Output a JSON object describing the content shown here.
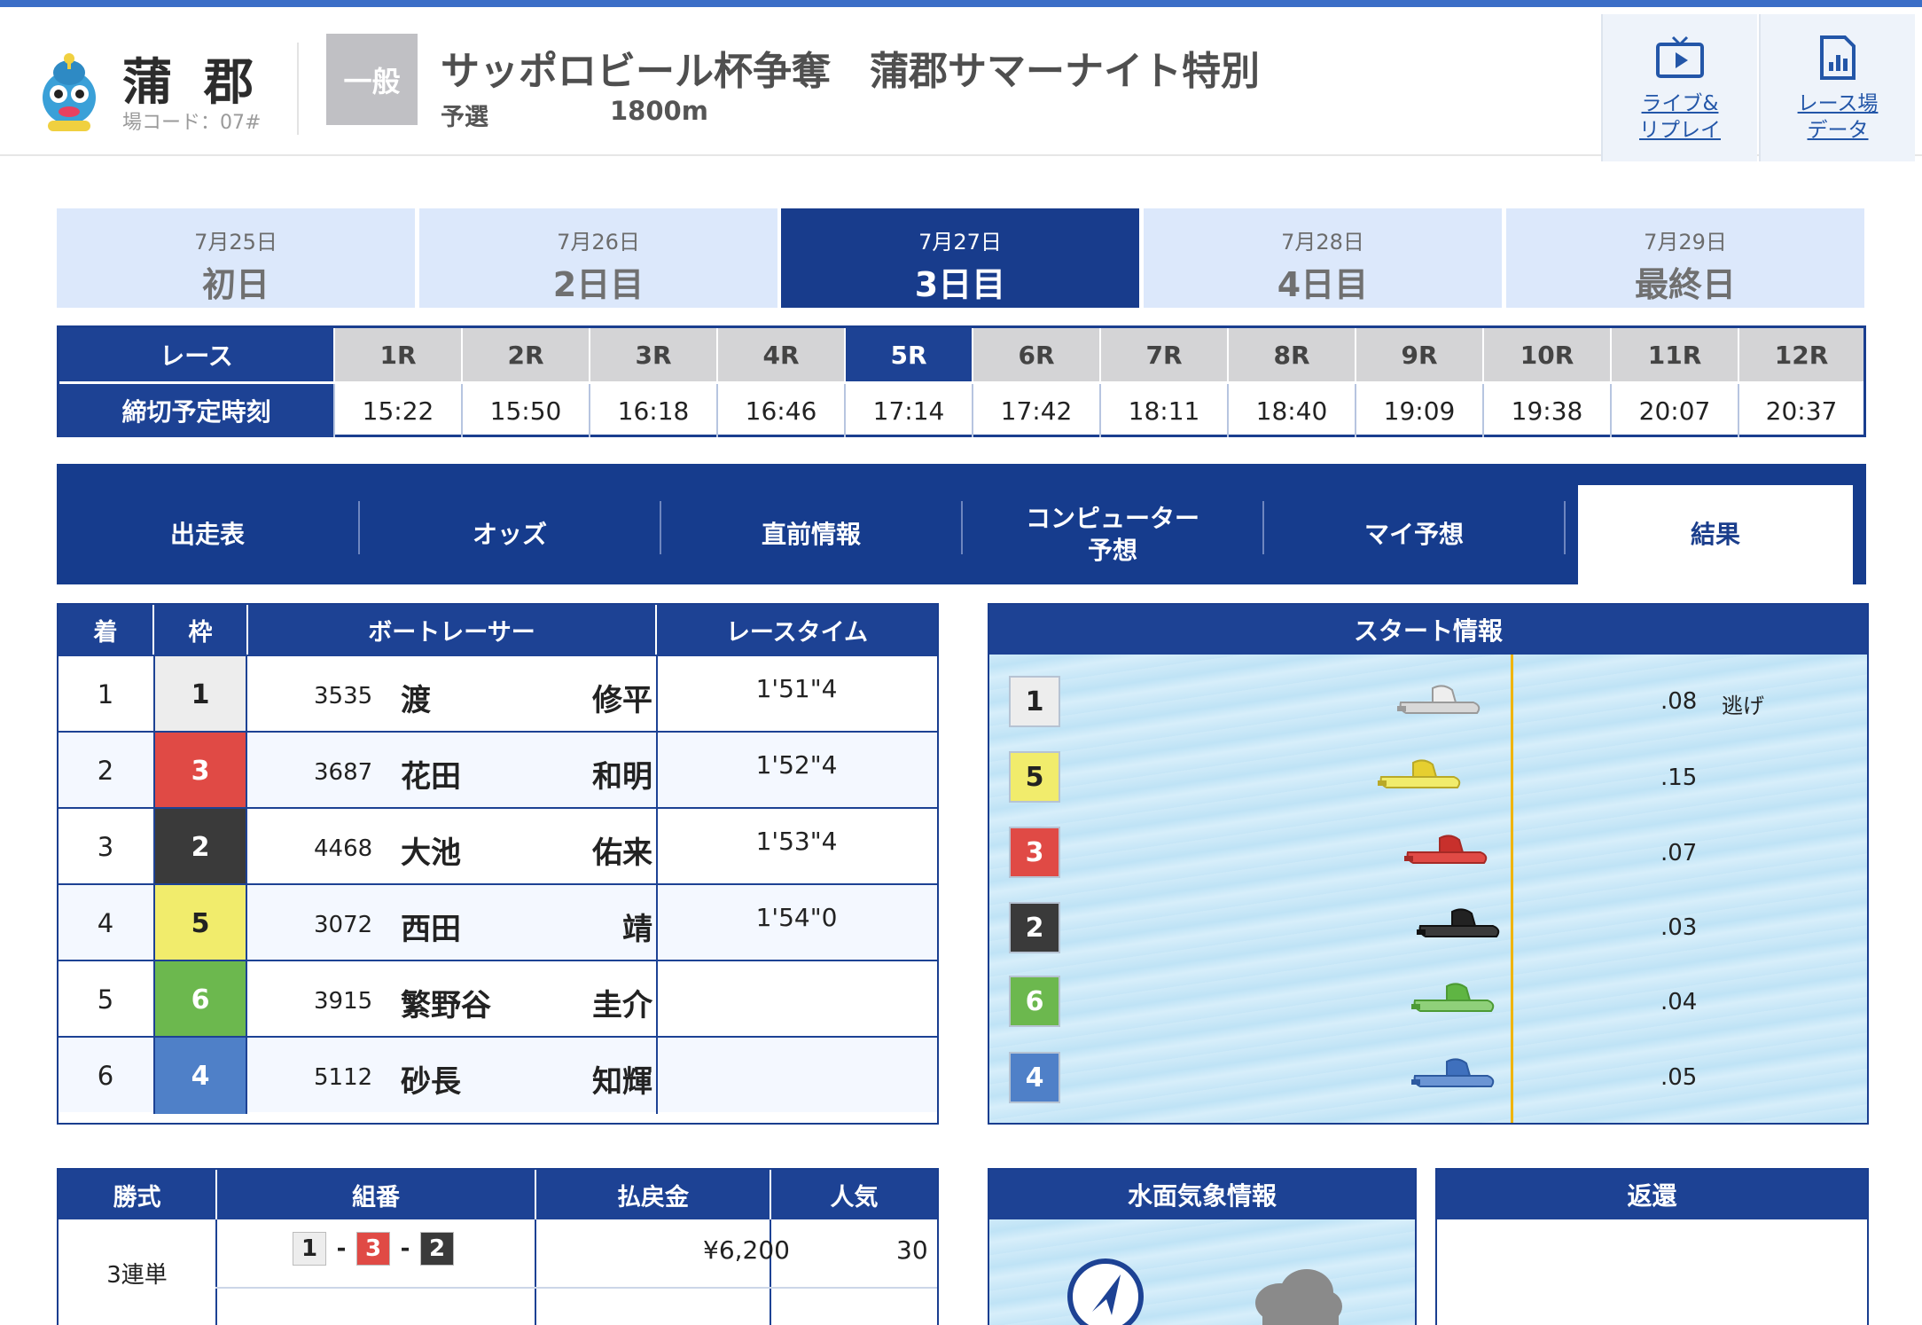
{
  "header": {
    "venue_name": "蒲郡",
    "venue_code": "場コード：07#",
    "grade": "一般",
    "race_title": "サッポロビール杯争奪　蒲郡サマーナイト特別",
    "race_stage": "予選",
    "distance": "1800m",
    "buttons": [
      {
        "label1": "ライブ&",
        "label2": "リプレイ",
        "icon": "tv-play-icon"
      },
      {
        "label1": "レース場",
        "label2": "データ",
        "icon": "document-chart-icon"
      }
    ]
  },
  "days": [
    {
      "date": "7月25日",
      "name": "初日"
    },
    {
      "date": "7月26日",
      "name": "2日目"
    },
    {
      "date": "7月27日",
      "name": "3日目"
    },
    {
      "date": "7月28日",
      "name": "4日目"
    },
    {
      "date": "7月29日",
      "name": "最終日"
    }
  ],
  "active_day": "3日目",
  "race_table": {
    "label_race": "レース",
    "label_time": "締切予定時刻",
    "races": [
      "1R",
      "2R",
      "3R",
      "4R",
      "5R",
      "6R",
      "7R",
      "8R",
      "9R",
      "10R",
      "11R",
      "12R"
    ],
    "times": [
      "15:22",
      "15:50",
      "16:18",
      "16:46",
      "17:14",
      "17:42",
      "18:11",
      "18:40",
      "19:09",
      "19:38",
      "20:07",
      "20:37"
    ],
    "active_race": "5R"
  },
  "nav": {
    "items": [
      {
        "label": "出走表"
      },
      {
        "label": "オッズ"
      },
      {
        "label": "直前情報"
      },
      {
        "label": "コンピューター",
        "label2": "予想"
      },
      {
        "label": "マイ予想"
      },
      {
        "label": "結果"
      }
    ],
    "active": "結果"
  },
  "results": {
    "headers": {
      "rank": "着",
      "frame": "枠",
      "racer": "ボートレーサー",
      "time": "レースタイム"
    },
    "rows": [
      {
        "rank": "1",
        "frame": "1",
        "number": "3535",
        "surname": "渡",
        "given": "修平",
        "time": "1'51\"4"
      },
      {
        "rank": "2",
        "frame": "3",
        "number": "3687",
        "surname": "花田",
        "given": "和明",
        "time": "1'52\"4"
      },
      {
        "rank": "3",
        "frame": "2",
        "number": "4468",
        "surname": "大池",
        "given": "佑来",
        "time": "1'53\"4"
      },
      {
        "rank": "4",
        "frame": "5",
        "number": "3072",
        "surname": "西田",
        "given": "靖",
        "time": "1'54\"0"
      },
      {
        "rank": "5",
        "frame": "6",
        "number": "3915",
        "surname": "繁野谷",
        "given": "圭介",
        "time": ""
      },
      {
        "rank": "6",
        "frame": "4",
        "number": "5112",
        "surname": "砂長",
        "given": "知輝",
        "time": ""
      }
    ]
  },
  "start_info": {
    "title": "スタート情報",
    "entries": [
      {
        "frame": "1",
        "st": ".08",
        "note": "逃げ"
      },
      {
        "frame": "5",
        "st": ".15",
        "note": ""
      },
      {
        "frame": "3",
        "st": ".07",
        "note": ""
      },
      {
        "frame": "2",
        "st": ".03",
        "note": ""
      },
      {
        "frame": "6",
        "st": ".04",
        "note": ""
      },
      {
        "frame": "4",
        "st": ".05",
        "note": ""
      }
    ]
  },
  "payout": {
    "headers": {
      "type": "勝式",
      "combo": "組番",
      "amount": "払戻金",
      "popularity": "人気"
    },
    "type": "3連単",
    "combo": [
      "1",
      "3",
      "2"
    ],
    "amount": "¥6,200",
    "popularity": "30"
  },
  "weather": {
    "title": "水面気象情報"
  },
  "refund": {
    "title": "返還"
  },
  "colors": {
    "navy": "#1d4294",
    "frame1": "#ededed",
    "frame2": "#3a3a3a",
    "frame3": "#e04a45",
    "frame4": "#4f80c8",
    "frame5": "#f1ec6c",
    "frame6": "#6cb84e"
  }
}
